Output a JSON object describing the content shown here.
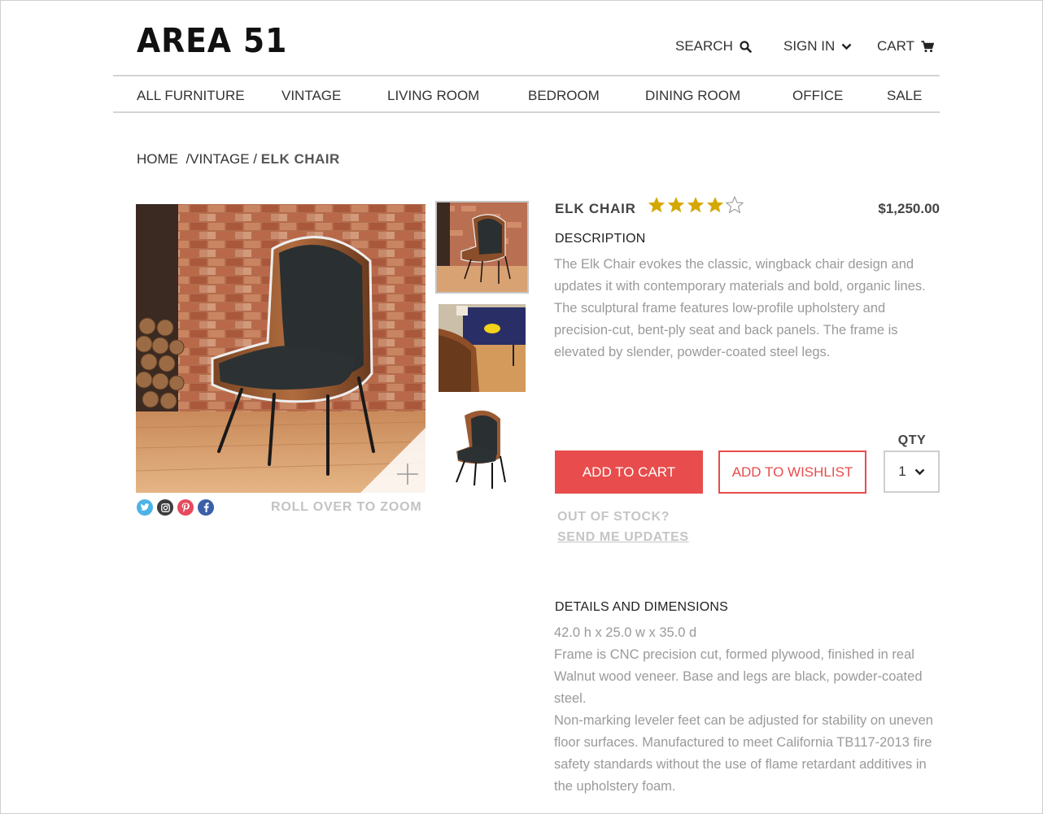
{
  "brand": {
    "logo": "AREA 51"
  },
  "header": {
    "search_label": "SEARCH",
    "signin_label": "SIGN IN",
    "cart_label": "CART"
  },
  "nav": {
    "items": [
      {
        "label": "ALL FURNITURE"
      },
      {
        "label": "VINTAGE"
      },
      {
        "label": "LIVING ROOM"
      },
      {
        "label": "BEDROOM"
      },
      {
        "label": "DINING ROOM"
      },
      {
        "label": "OFFICE"
      },
      {
        "label": "SALE"
      }
    ]
  },
  "breadcrumb": {
    "home": "HOME",
    "sep1": "  /",
    "category": "VINTAGE",
    "sep2": " / ",
    "current": "ELK CHAIR"
  },
  "gallery": {
    "zoom_hint": "ROLL OVER TO ZOOM",
    "social": [
      "twitter-icon",
      "instagram-icon",
      "pinterest-icon",
      "facebook-icon"
    ],
    "thumbnails": [
      "elk-chair-brick-wall",
      "elk-chair-living-room",
      "elk-chair-white-background"
    ],
    "selected_thumbnail": 0
  },
  "product": {
    "name": "ELK CHAIR",
    "rating": 4,
    "rating_max": 5,
    "price": "$1,250.00",
    "description_heading": "DESCRIPTION",
    "description": "The Elk Chair evokes the classic, wingback chair design and updates it with contemporary materials and bold, organic lines. The sculptural frame features low-profile upholstery and precision-cut, bent-ply seat and back panels.  The frame is elevated by slender, powder-coated steel legs.",
    "add_to_cart": "ADD TO CART",
    "add_to_wishlist": "ADD TO WISHLIST",
    "qty_label": "QTY",
    "qty_value": "1",
    "out_of_stock": "OUT OF STOCK?",
    "send_updates": "SEND ME UPDATES",
    "details_heading": "DETAILS AND DIMENSIONS",
    "dimensions": "42.0 h x 25.0 w x 35.0 d",
    "details_1": "Frame is CNC precision cut, formed plywood, finished in real Walnut wood veneer. Base and legs are black, powder-coated steel.",
    "details_2": "Non-marking leveler feet can be adjusted for stability on uneven floor surfaces. Manufactured to meet California TB117-2013 fire safety standards without the use of flame retardant additives in the upholstery foam."
  },
  "colors": {
    "accent": "#e84c4c",
    "star": "#d4a800",
    "muted_text": "#9a9a9a"
  }
}
